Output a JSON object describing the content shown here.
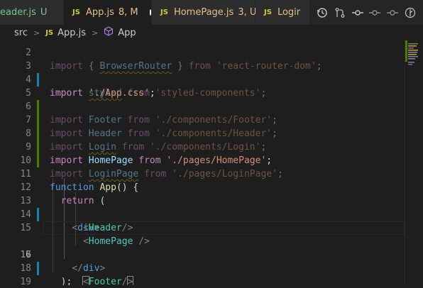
{
  "tabs": [
    {
      "icon": "",
      "name": "eader.js",
      "status": "U",
      "active": false
    },
    {
      "icon": "JS",
      "name": "App.js",
      "status": "8, M",
      "active": true,
      "modified": true
    },
    {
      "icon": "JS",
      "name": "HomePage.js",
      "status": "3, U",
      "active": false
    },
    {
      "icon": "JS",
      "name": "Logir",
      "status": "",
      "active": false
    }
  ],
  "breadcrumb": {
    "folder": "src",
    "file_icon": "JS",
    "file": "App.js",
    "symbol": "App"
  },
  "editor": {
    "current_line": "16",
    "lines": [
      {
        "n": "2",
        "text": "import { BrowserRouter } from 'react-router-dom';"
      },
      {
        "n": "3",
        "text": "import styled from 'styled-components';"
      },
      {
        "n": "4",
        "text": "import './App.css';"
      },
      {
        "n": "5",
        "text": "import Footer from './components/Footer';"
      },
      {
        "n": "6",
        "text": "import Header from './components/Header';"
      },
      {
        "n": "7",
        "text": "import Login from './components/Login';"
      },
      {
        "n": "8",
        "text": "import HomePage from './pages/HomePage';"
      },
      {
        "n": "9",
        "text": "import LoginPage from './pages/LoginPage';"
      },
      {
        "n": "10",
        "text": ""
      },
      {
        "n": "11",
        "text": "function App() {"
      },
      {
        "n": "12",
        "text": "  return ("
      },
      {
        "n": "13",
        "text": "    <div>"
      },
      {
        "n": "14",
        "text": "      <Header/>"
      },
      {
        "n": "15",
        "text": "      <HomePage />"
      },
      {
        "n": "16",
        "text": "      <Footer/>"
      },
      {
        "n": "17",
        "text": "    </div>"
      },
      {
        "n": "18",
        "text": "  );"
      },
      {
        "n": "19",
        "text": "}"
      }
    ]
  },
  "colors": {
    "modified_gutter": "#487e02",
    "added_gutter": "#1b81a8",
    "accent_tab_text": "#e2c08d",
    "js_icon": "#cbcb41"
  },
  "icons": [
    "timeline-icon",
    "source-control-icon",
    "git-commit-icon",
    "git-previous-icon",
    "git-next-icon",
    "git-compare-icon"
  ]
}
